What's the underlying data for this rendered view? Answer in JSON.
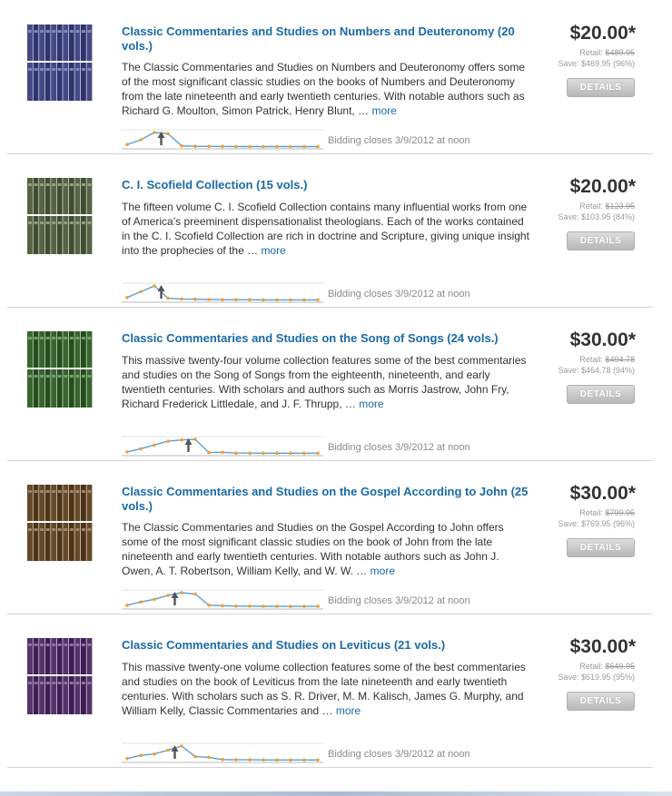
{
  "products": [
    {
      "title": "Classic Commentaries and Studies on Numbers and Deuteronomy (20 vols.)",
      "description": "The Classic Commentaries and Studies on Numbers and Deuteronomy offers some of the most significant classic studies on the books of Numbers and Deuteronomy from the late nineteenth and early twentieth centuries. With notable authors such as Richard G. Moulton, Simon Patrick, Henry Blunt, …",
      "more_label": "more",
      "bidding_closes": "Bidding closes 3/9/2012 at noon",
      "price": "$20.00*",
      "retail_label": "Retail:",
      "retail_price": "$489.95",
      "save_text": "Save: $469.95 (96%)",
      "details_label": "DETAILS",
      "book_color": "#3b3f7a",
      "bid_history": [
        2,
        6,
        12,
        11,
        1,
        0.6,
        0.5,
        0.5,
        0.4,
        0.4,
        0.4,
        0.4,
        0.4,
        0.4,
        0.4
      ],
      "current_index": 3
    },
    {
      "title": "C. I. Scofield Collection (15 vols.)",
      "description": "The fifteen volume C. I. Scofield Collection contains many influential works from one of America’s preeminent dispensationalist theologians. Each of the works contained in the C. I. Scofield Collection are rich in doctrine and Scripture, giving unique insight into the prophecies of the …",
      "more_label": "more",
      "bidding_closes": "Bidding closes 3/9/2012 at noon",
      "price": "$20.00*",
      "retail_label": "Retail:",
      "retail_price": "$123.95",
      "save_text": "Save: $103.95 (84%)",
      "details_label": "DETAILS",
      "book_color": "#4d5a3a",
      "bid_history": [
        2,
        6,
        10,
        1.5,
        1,
        0.8,
        0.6,
        0.5,
        0.5,
        0.5,
        0.4,
        0.4,
        0.4,
        0.4,
        0.4
      ],
      "current_index": 3
    },
    {
      "title": "Classic Commentaries and Studies on the Song of Songs (24 vols.)",
      "description": "This massive twenty-four volume collection features some of the best commentaries and studies on the Song of Songs from the eighteenth, nineteenth, and early twentieth centuries. With scholars and authors such as Morris Jastrow, John Fry, Richard Frederick Littledale, and J. F. Thrupp, …",
      "more_label": "more",
      "bidding_closes": "Bidding closes 3/9/2012 at noon",
      "price": "$30.00*",
      "retail_label": "Retail:",
      "retail_price": "$494.78",
      "save_text": "Save: $464.78 (94%)",
      "details_label": "DETAILS",
      "book_color": "#2f5a25",
      "bid_history": [
        1.5,
        4,
        7,
        10,
        11,
        11.5,
        1,
        1.2,
        0.6,
        0.6,
        0.5,
        0.5,
        0.5,
        0.5,
        0.5
      ],
      "current_index": 5
    },
    {
      "title": "Classic Commentaries and Studies on the Gospel According to John (25 vols.)",
      "description": "The Classic Commentaries and Studies on the Gospel According to John offers some of the most significant classic studies on the book of John from the late nineteenth and early twentieth centuries. With notable authors such as John J. Owen, A. T. Robertson, William Kelly, and W. W. …",
      "more_label": "more",
      "bidding_closes": "Bidding closes 3/9/2012 at noon",
      "price": "$30.00*",
      "retail_label": "Retail:",
      "retail_price": "$799.95",
      "save_text": "Save: $769.95 (96%)",
      "details_label": "DETAILS",
      "book_color": "#5a4020",
      "bid_history": [
        1.5,
        4,
        6,
        9,
        11,
        10,
        1.5,
        1.2,
        0.8,
        0.8,
        0.7,
        0.6,
        0.6,
        0.6,
        0.6
      ],
      "current_index": 4
    },
    {
      "title": "Classic Commentaries and Studies on Leviticus (21 vols.)",
      "description": "This massive twenty-one volume collection features some of the best commentaries and studies on the book of Leviticus from the late nineteenth and early twentieth centuries. With scholars such as S. R. Driver, M. M. Kalisch, James G. Murphy, and William Kelly, Classic Commentaries and …",
      "more_label": "more",
      "bidding_closes": "Bidding closes 3/9/2012 at noon",
      "price": "$30.00*",
      "retail_label": "Retail:",
      "retail_price": "$649.95",
      "save_text": "Save: $619.95 (95%)",
      "details_label": "DETAILS",
      "book_color": "#4a2860",
      "bid_history": [
        1.5,
        4,
        5,
        8,
        11,
        3,
        2.5,
        0.8,
        0.6,
        0.6,
        0.5,
        0.5,
        0.5,
        0.5,
        0.5
      ],
      "current_index": 4
    }
  ]
}
